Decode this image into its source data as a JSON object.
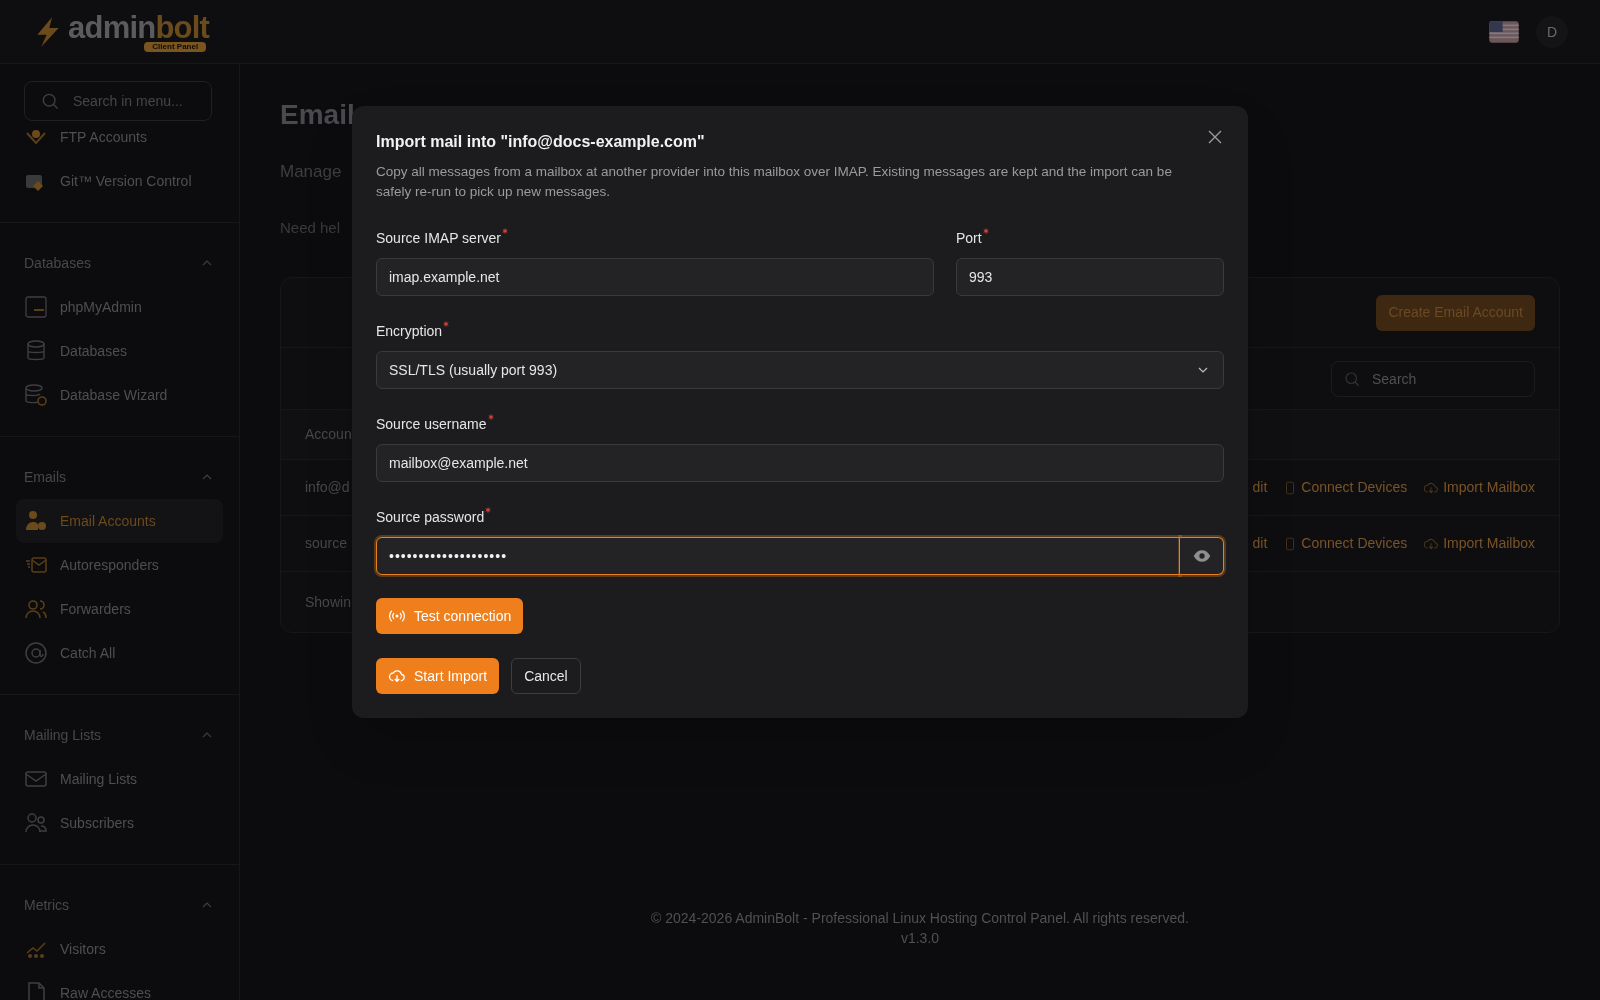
{
  "header": {
    "logo": {
      "parts": [
        "admin",
        "bolt"
      ],
      "badge": "Client Panel"
    },
    "avatar": "D"
  },
  "sidebar": {
    "search_placeholder": "Search in menu...",
    "groups": [
      {
        "items": [
          {
            "label": "FTP Accounts",
            "selected": false
          },
          {
            "label": "Git™ Version Control",
            "selected": false
          }
        ]
      },
      {
        "title": "Databases",
        "expanded": true,
        "items": [
          {
            "label": "phpMyAdmin",
            "selected": false
          },
          {
            "label": "Databases",
            "selected": false
          },
          {
            "label": "Database Wizard",
            "selected": false
          }
        ]
      },
      {
        "title": "Emails",
        "expanded": true,
        "items": [
          {
            "label": "Email Accounts",
            "selected": true
          },
          {
            "label": "Autoresponders",
            "selected": false
          },
          {
            "label": "Forwarders",
            "selected": false
          },
          {
            "label": "Catch All",
            "selected": false
          }
        ]
      },
      {
        "title": "Mailing Lists",
        "expanded": true,
        "items": [
          {
            "label": "Mailing Lists",
            "selected": false
          },
          {
            "label": "Subscribers",
            "selected": false
          }
        ]
      },
      {
        "title": "Metrics",
        "expanded": true,
        "items": [
          {
            "label": "Visitors",
            "selected": false
          },
          {
            "label": "Raw Accesses",
            "selected": false
          }
        ]
      }
    ]
  },
  "page": {
    "title": "Email",
    "subtitle": "Manage",
    "help": "Need hel",
    "create_button": "Create Email Account",
    "search_placeholder": "Search",
    "column_1": "Accoun",
    "rows": [
      {
        "account": "info@d",
        "edit": "dit",
        "connect": "Connect Devices",
        "import": "Import Mailbox"
      },
      {
        "account": "source",
        "edit": "dit",
        "connect": "Connect Devices",
        "import": "Import Mailbox"
      }
    ],
    "footer": "Showin"
  },
  "modal": {
    "title": "Import mail into \"info@docs-example.com\"",
    "description": "Copy all messages from a mailbox at another provider into this mailbox over IMAP. Existing messages are kept and the import can be safely re-run to pick up new messages.",
    "rows": [
      [
        {
          "kind": "text",
          "label": "Source IMAP server",
          "required": true,
          "value": "imap.example.net",
          "focused": false
        },
        {
          "kind": "text",
          "label": "Port",
          "required": true,
          "value": "993",
          "focused": false
        }
      ],
      [
        {
          "kind": "select",
          "label": "Encryption",
          "required": true,
          "value": "SSL/TLS (usually port 993)",
          "focused": false
        }
      ],
      [
        {
          "kind": "text",
          "label": "Source username",
          "required": true,
          "value": "mailbox@example.net",
          "focused": false
        }
      ],
      [
        {
          "kind": "password",
          "label": "Source password",
          "required": true,
          "value": "••••••••••••••••••••",
          "focused": true
        }
      ]
    ],
    "test_button": "Test connection",
    "actions": [
      {
        "label": "Start Import",
        "kind": "primary"
      },
      {
        "label": "Cancel",
        "kind": "secondary"
      }
    ]
  },
  "footer": {
    "copyright": "© 2024-2026 AdminBolt - Professional Linux Hosting Control Panel. All rights reserved.",
    "version": "v1.3.0"
  }
}
